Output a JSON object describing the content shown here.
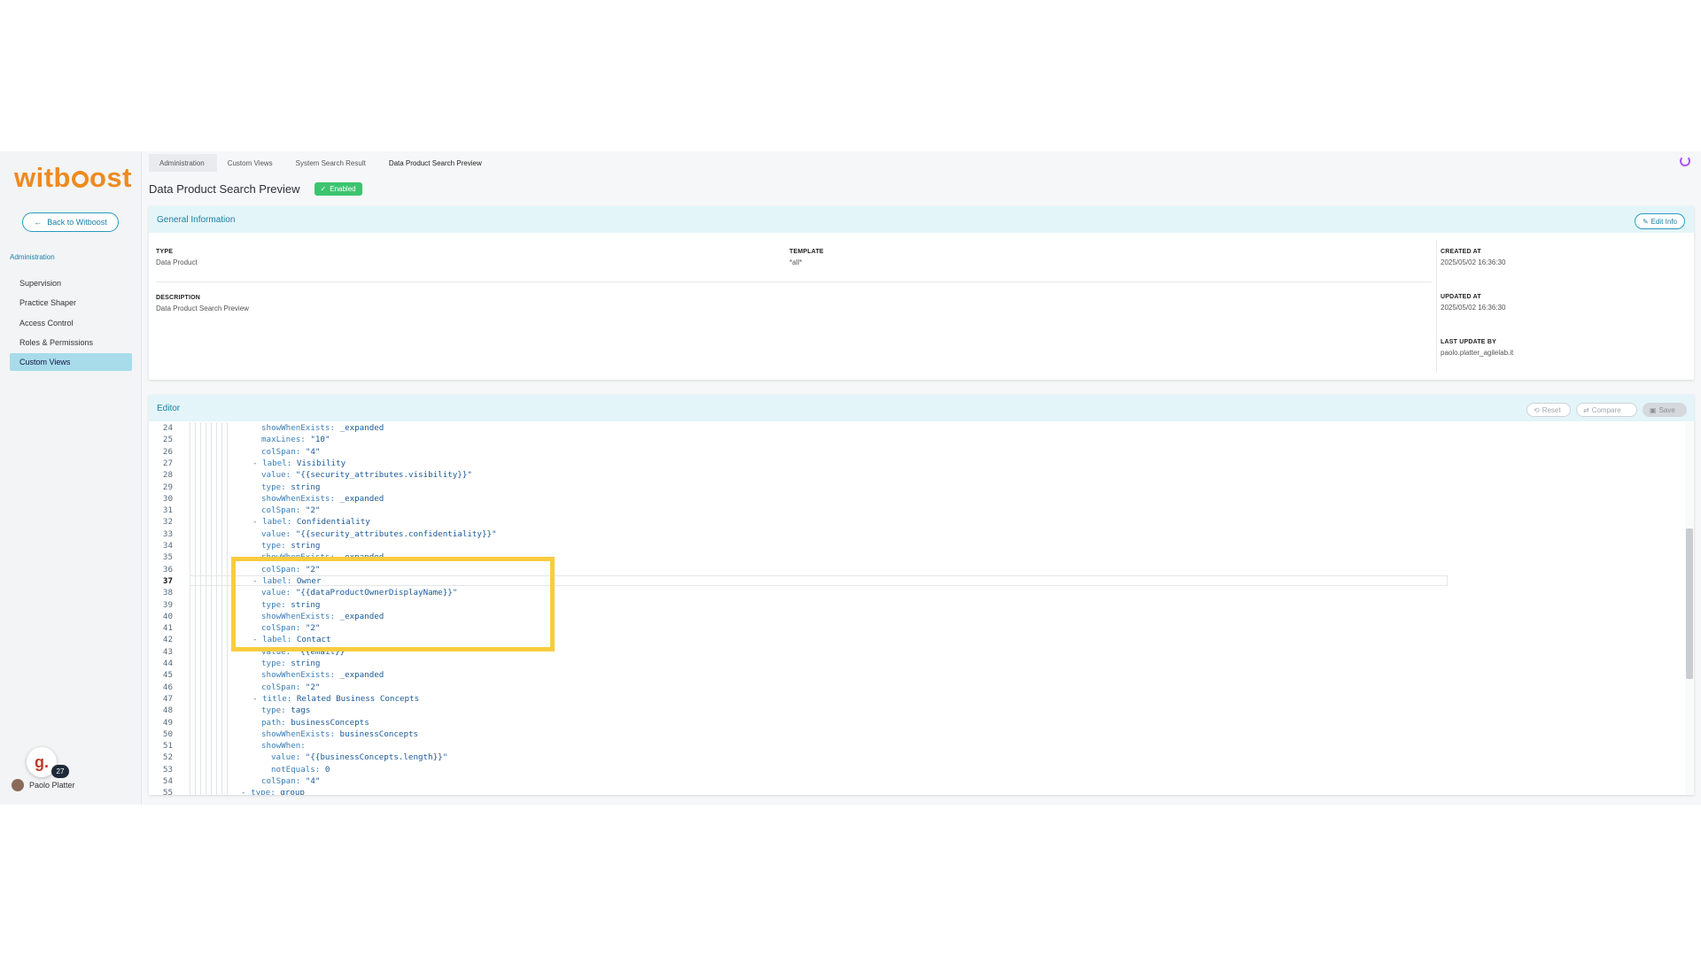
{
  "logo": "witboost",
  "sidebar": {
    "back_label": "Back to Witboost",
    "section": "Administration",
    "items": [
      "Supervision",
      "Practice Shaper",
      "Access Control",
      "Roles & Permissions",
      "Custom Views"
    ],
    "active_index": 4,
    "notification_glyph": "g.",
    "notification_count": "27",
    "user_name": "Paolo Platter"
  },
  "breadcrumb": [
    "Administration",
    "Custom Views",
    "System Search Result",
    "Data Product Search Preview"
  ],
  "page": {
    "title": "Data Product Search Preview",
    "status": "Enabled"
  },
  "general": {
    "heading": "General Information",
    "edit_label": "Edit Info",
    "type_label": "TYPE",
    "type_value": "Data Product",
    "template_label": "TEMPLATE",
    "template_value": "*all*",
    "description_label": "DESCRIPTION",
    "description_value": "Data Product Search Preview",
    "created_label": "CREATED AT",
    "created_value": "2025/05/02 16:36:30",
    "updated_label": "UPDATED AT",
    "updated_value": "2025/05/02 16:36:30",
    "lastby_label": "LAST UPDATE BY",
    "lastby_value": "paolo.platter_agilelab.it"
  },
  "editor": {
    "heading": "Editor",
    "reset_label": "Reset",
    "compare_label": "Compare",
    "save_label": "Save",
    "active_line": 37,
    "lines": [
      {
        "n": "24",
        "indent": 2,
        "key": "showWhenExists",
        "val": "_expanded"
      },
      {
        "n": "25",
        "indent": 2,
        "key": "maxLines",
        "val": "\"10\""
      },
      {
        "n": "26",
        "indent": 2,
        "key": "colSpan",
        "val": "\"4\""
      },
      {
        "n": "27",
        "indent": 1,
        "dash": true,
        "key": "label",
        "val": "Visibility"
      },
      {
        "n": "28",
        "indent": 2,
        "key": "value",
        "val": "\"{{security_attributes.visibility}}\""
      },
      {
        "n": "29",
        "indent": 2,
        "key": "type",
        "val": "string"
      },
      {
        "n": "30",
        "indent": 2,
        "key": "showWhenExists",
        "val": "_expanded"
      },
      {
        "n": "31",
        "indent": 2,
        "key": "colSpan",
        "val": "\"2\""
      },
      {
        "n": "32",
        "indent": 1,
        "dash": true,
        "key": "label",
        "val": "Confidentiality"
      },
      {
        "n": "33",
        "indent": 2,
        "key": "value",
        "val": "\"{{security_attributes.confidentiality}}\""
      },
      {
        "n": "34",
        "indent": 2,
        "key": "type",
        "val": "string"
      },
      {
        "n": "35",
        "indent": 2,
        "key": "showWhenExists",
        "val": "_expanded"
      },
      {
        "n": "36",
        "indent": 2,
        "key": "colSpan",
        "val": "\"2\""
      },
      {
        "n": "37",
        "indent": 1,
        "dash": true,
        "key": "label",
        "val": "Owner"
      },
      {
        "n": "38",
        "indent": 2,
        "key": "value",
        "val": "\"{{dataProductOwnerDisplayName}}\""
      },
      {
        "n": "39",
        "indent": 2,
        "key": "type",
        "val": "string"
      },
      {
        "n": "40",
        "indent": 2,
        "key": "showWhenExists",
        "val": "_expanded"
      },
      {
        "n": "41",
        "indent": 2,
        "key": "colSpan",
        "val": "\"2\""
      },
      {
        "n": "42",
        "indent": 1,
        "dash": true,
        "key": "label",
        "val": "Contact"
      },
      {
        "n": "43",
        "indent": 2,
        "key": "value",
        "val": "\"{{email}}\""
      },
      {
        "n": "44",
        "indent": 2,
        "key": "type",
        "val": "string"
      },
      {
        "n": "45",
        "indent": 2,
        "key": "showWhenExists",
        "val": "_expanded"
      },
      {
        "n": "46",
        "indent": 2,
        "key": "colSpan",
        "val": "\"2\""
      },
      {
        "n": "47",
        "indent": 1,
        "dash": true,
        "key": "title",
        "val": "Related Business Concepts"
      },
      {
        "n": "48",
        "indent": 2,
        "key": "type",
        "val": "tags"
      },
      {
        "n": "49",
        "indent": 2,
        "key": "path",
        "val": "businessConcepts"
      },
      {
        "n": "50",
        "indent": 2,
        "key": "showWhenExists",
        "val": "businessConcepts"
      },
      {
        "n": "51",
        "indent": 2,
        "key": "showWhen",
        "val": ""
      },
      {
        "n": "52",
        "indent": 3,
        "key": "value",
        "val": "\"{{businessConcepts.length}}\""
      },
      {
        "n": "53",
        "indent": 3,
        "key": "notEquals",
        "val": "0"
      },
      {
        "n": "54",
        "indent": 2,
        "key": "colSpan",
        "val": "\"4\""
      },
      {
        "n": "55",
        "indent": 0,
        "dash": true,
        "key": "type",
        "val": "group"
      }
    ]
  },
  "colors": {
    "accent": "#1a7fa6",
    "brand": "#ee8a1f",
    "highlight": "#f9cc3f",
    "enabled": "#3cc46f"
  }
}
